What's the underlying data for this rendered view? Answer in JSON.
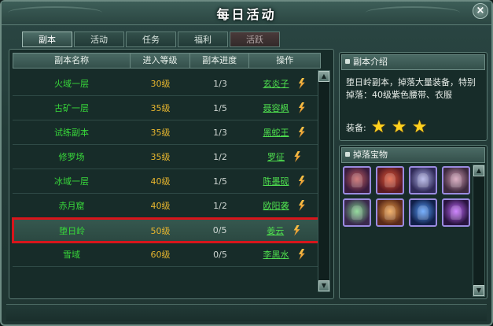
{
  "window": {
    "title": "每日活动",
    "close_icon": "close-icon"
  },
  "tabs": [
    {
      "label": "副本",
      "active": true
    },
    {
      "label": "活动",
      "active": false
    },
    {
      "label": "任务",
      "active": false
    },
    {
      "label": "福利",
      "active": false
    },
    {
      "label": "活跃",
      "active": false
    }
  ],
  "table": {
    "headers": [
      "副本名称",
      "进入等级",
      "副本进度",
      "操作"
    ],
    "rows": [
      {
        "name": "火域一层",
        "level": "30级",
        "progress": "1/3",
        "npc": "玄炎子"
      },
      {
        "name": "古矿一层",
        "level": "35级",
        "progress": "1/5",
        "npc": "聂容枫"
      },
      {
        "name": "试练副本",
        "level": "35级",
        "progress": "1/3",
        "npc": "黑蛇王"
      },
      {
        "name": "修罗场",
        "level": "35级",
        "progress": "1/2",
        "npc": "罗征"
      },
      {
        "name": "冰域一层",
        "level": "40级",
        "progress": "1/5",
        "npc": "陈墨砚"
      },
      {
        "name": "赤月窟",
        "level": "40级",
        "progress": "1/2",
        "npc": "欧阳袭"
      },
      {
        "name": "堕日岭",
        "level": "50级",
        "progress": "0/5",
        "npc": "姜云",
        "selected": true
      },
      {
        "name": "雪域",
        "level": "60级",
        "progress": "0/5",
        "npc": "李黑水"
      }
    ],
    "op_icon": "fly-icon"
  },
  "intro": {
    "title": "副本介绍",
    "text": "堕日岭副本，掉落大量装备，特别掉落：40级紫色腰带、衣服",
    "equip_label": "装备:",
    "stars": 3
  },
  "drops": {
    "title": "掉落宝物",
    "items": [
      "helm-icon",
      "armor-icon",
      "armor-icon",
      "armor-icon",
      "boots-icon",
      "belt-icon",
      "gem-icon",
      "gem-icon"
    ]
  }
}
